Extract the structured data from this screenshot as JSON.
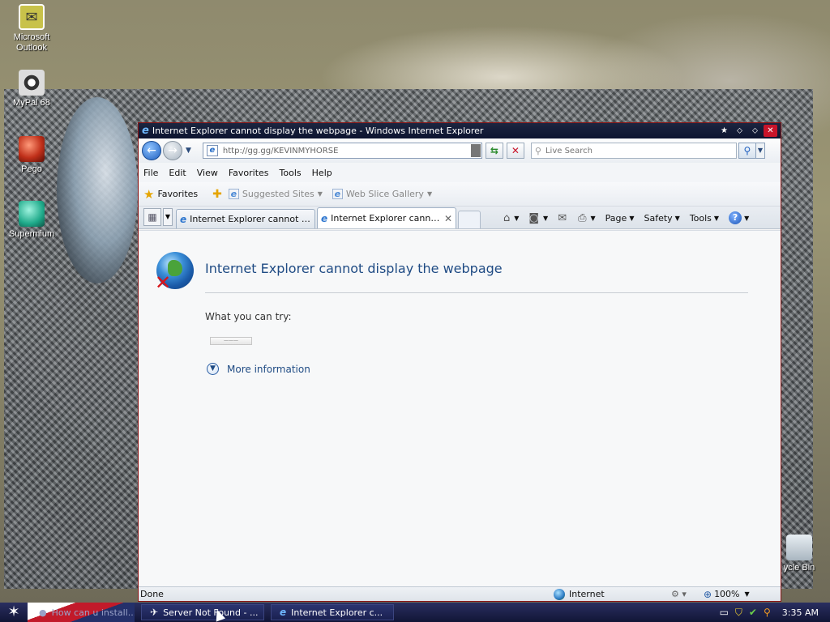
{
  "desktop": {
    "icons": [
      {
        "label": "Microsoft Outlook"
      },
      {
        "label": "MyPal 68"
      },
      {
        "label": "Pego"
      },
      {
        "label": "Supermium"
      },
      {
        "label": "ycle Bin"
      }
    ]
  },
  "window": {
    "title": "Internet Explorer cannot display the webpage - Windows Internet Explorer",
    "address": "http://gg.gg/KEVINMYHORSE",
    "search_placeholder": "Live Search",
    "menu": [
      "File",
      "Edit",
      "View",
      "Favorites",
      "Tools",
      "Help"
    ],
    "favorites_label": "Favorites",
    "fav_links": [
      "Suggested Sites",
      "Web Slice Gallery"
    ],
    "tabs": [
      {
        "label": "Internet Explorer cannot dis..."
      },
      {
        "label": "Internet Explorer cannot ..."
      }
    ],
    "commands": {
      "page": "Page",
      "safety": "Safety",
      "tools": "Tools"
    }
  },
  "page": {
    "error_title": "Internet Explorer cannot display the webpage",
    "try_label": "What you can try:",
    "diagnose_label": "———",
    "more_info": "More information"
  },
  "status": {
    "text": "Done",
    "zone": "Internet",
    "zoom": "100%"
  },
  "taskbar": {
    "items": [
      {
        "label": "How can u install..."
      },
      {
        "label": "Server Not Found - ..."
      },
      {
        "label": "Internet Explorer c..."
      }
    ],
    "clock": "3:35 AM"
  },
  "colors": {
    "title_bar": "#0d1430",
    "window_border": "#8a1414",
    "link_blue": "#1f4b84",
    "taskbar": "#1a1f4c"
  }
}
